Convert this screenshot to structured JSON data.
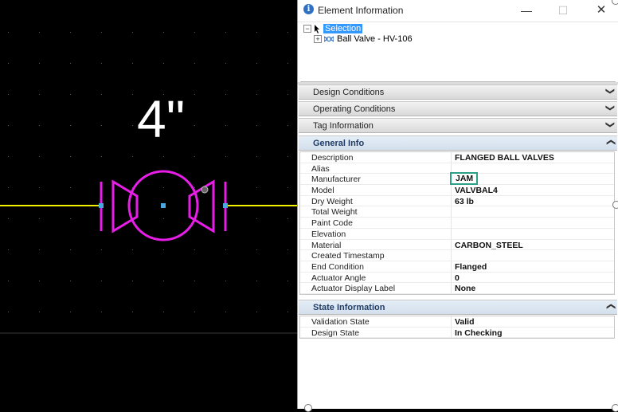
{
  "canvas": {
    "dimension_label": "4\""
  },
  "window": {
    "title": "Element Information",
    "minimize": "—",
    "maximize": "☐",
    "close": "✕"
  },
  "tree": {
    "root_label": "Selection",
    "root_expander": "−",
    "child_expander": "+",
    "child_label": "Ball Valve - HV-106"
  },
  "sections": {
    "design_conditions": "Design Conditions",
    "operating_conditions": "Operating Conditions",
    "tag_information": "Tag Information",
    "general_info": "General Info",
    "state_information": "State Information"
  },
  "general_info": [
    {
      "key": "Description",
      "value": "FLANGED BALL VALVES"
    },
    {
      "key": "Alias",
      "value": ""
    },
    {
      "key": "Manufacturer",
      "value": "JAM"
    },
    {
      "key": "Model",
      "value": "VALVBAL4"
    },
    {
      "key": "Dry Weight",
      "value": "63 lb"
    },
    {
      "key": "Total Weight",
      "value": ""
    },
    {
      "key": "Paint Code",
      "value": ""
    },
    {
      "key": "Elevation",
      "value": ""
    },
    {
      "key": "Material",
      "value": "CARBON_STEEL"
    },
    {
      "key": "Created Timestamp",
      "value": ""
    },
    {
      "key": "End Condition",
      "value": "Flanged"
    },
    {
      "key": "Actuator Angle",
      "value": "0"
    },
    {
      "key": "Actuator Display Label",
      "value": "None"
    }
  ],
  "state_information": [
    {
      "key": "Validation State",
      "value": "Valid"
    },
    {
      "key": "Design State",
      "value": "In Checking"
    }
  ],
  "colors": {
    "valve": "#e81ee8",
    "pipe": "#f2f200",
    "connector": "#4aa8e0",
    "highlight_border": "#2aa186",
    "selection": "#3399ff"
  }
}
